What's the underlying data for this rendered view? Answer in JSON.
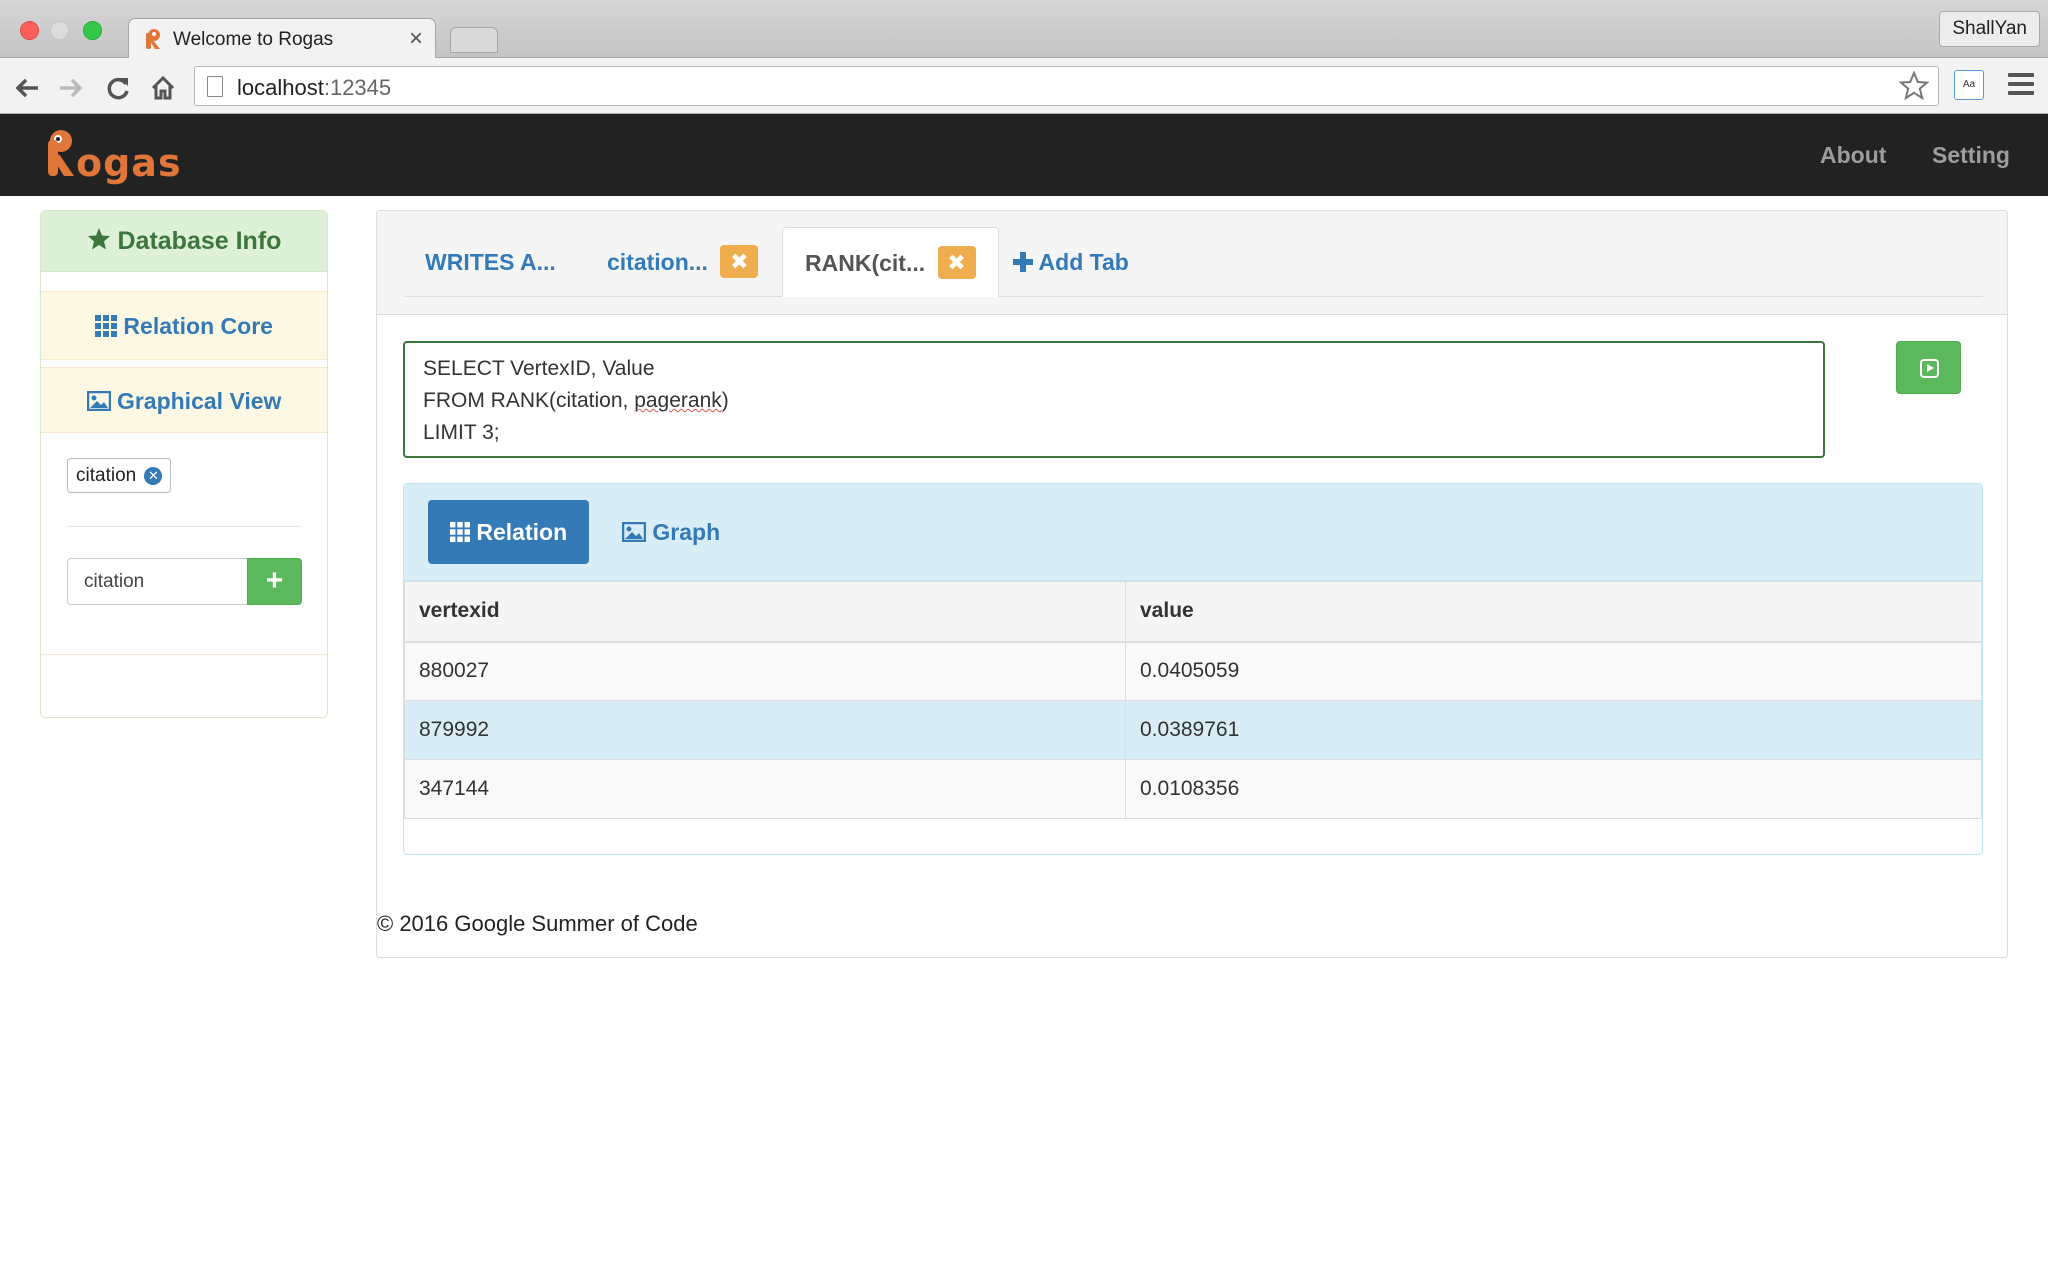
{
  "browser": {
    "tab_title": "Welcome to Rogas",
    "tab_close": "×",
    "profile_name": "ShallYan",
    "url_host": "localhost",
    "url_port": ":12345"
  },
  "navbar": {
    "brand": "Rogas",
    "links": [
      "About",
      "Setting"
    ]
  },
  "sidebar": {
    "header": "Database Info",
    "items": [
      "Relation Core",
      "Graphical View"
    ],
    "tag": "citation",
    "input_value": "citation",
    "add_label": "+"
  },
  "main": {
    "tabs": [
      {
        "label": "WRITES A..."
      },
      {
        "label": "citation..."
      },
      {
        "label": "RANK(cit..."
      }
    ],
    "add_tab_label": "Add Tab",
    "query_lines": [
      "SELECT VertexID, Value",
      "FROM RANK(citation, ",
      "pagerank",
      ")",
      "LIMIT 3;"
    ],
    "result_tabs": [
      "Relation",
      "Graph"
    ],
    "table": {
      "headers": [
        "vertexid",
        "value"
      ],
      "rows": [
        [
          "880027",
          "0.0405059"
        ],
        [
          "879992",
          "0.0389761"
        ],
        [
          "347144",
          "0.0108356"
        ]
      ]
    },
    "footer": "© 2016 Google Summer of Code"
  },
  "colors": {
    "brand_orange": "#e0763a",
    "primary": "#337ab7",
    "success": "#5cb85c",
    "warning": "#f0ad4e",
    "navbar_bg": "#222222"
  }
}
